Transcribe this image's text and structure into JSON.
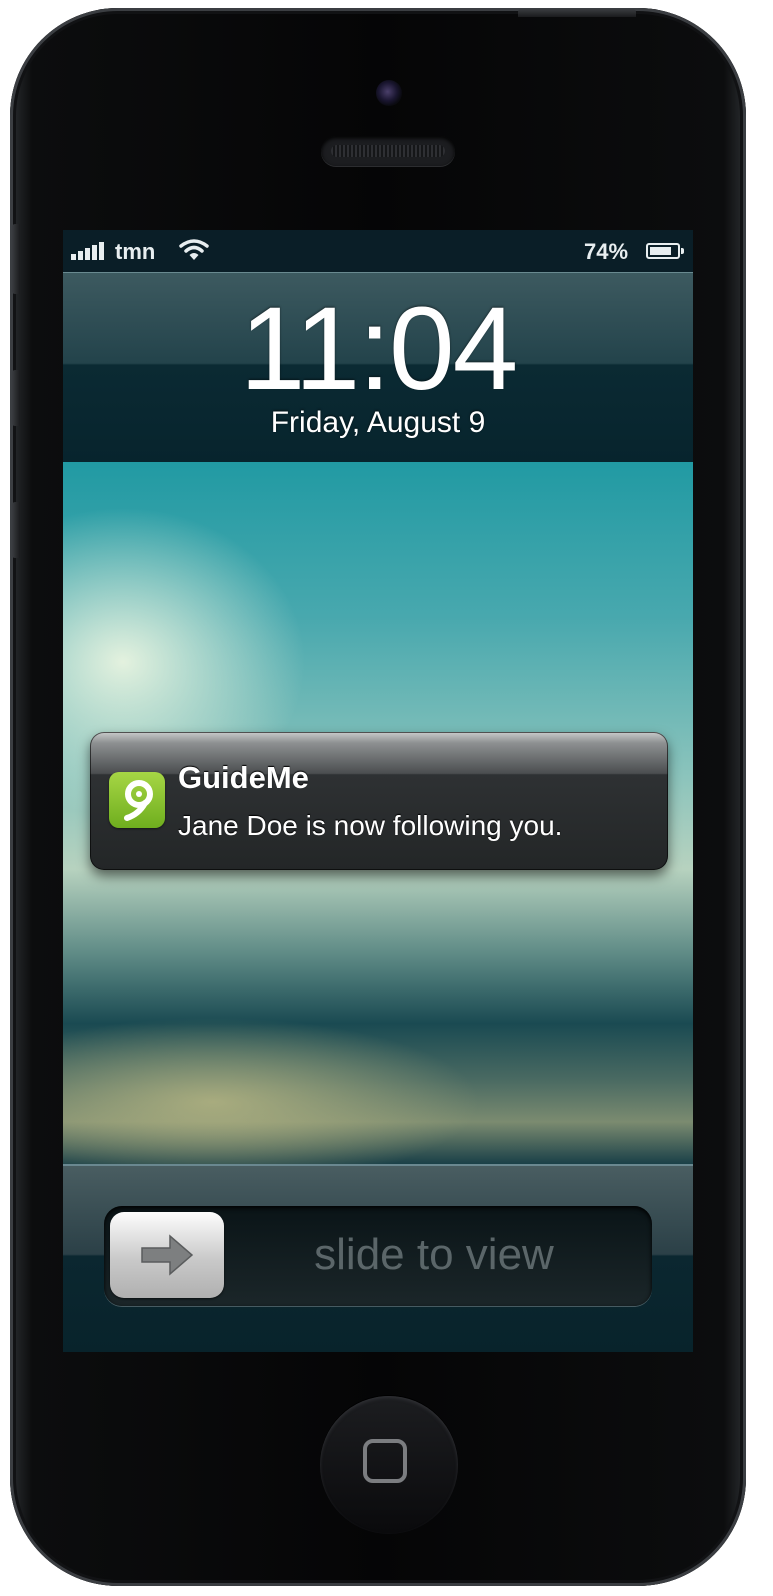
{
  "status_bar": {
    "carrier": "tmn",
    "battery_percent": "74%",
    "battery_level": 0.74,
    "signal_bars": 5,
    "icons": [
      "signal-icon",
      "wifi-icon",
      "battery-icon"
    ]
  },
  "lock_screen": {
    "time": "11:04",
    "date": "Friday, August 9"
  },
  "notification": {
    "app_name": "GuideMe",
    "message": "Jane Doe is now following you.",
    "icon": "map-pin-icon",
    "icon_color": "#8bc53a"
  },
  "unlock": {
    "label": "slide to view",
    "knob_icon": "arrow-right-icon"
  }
}
